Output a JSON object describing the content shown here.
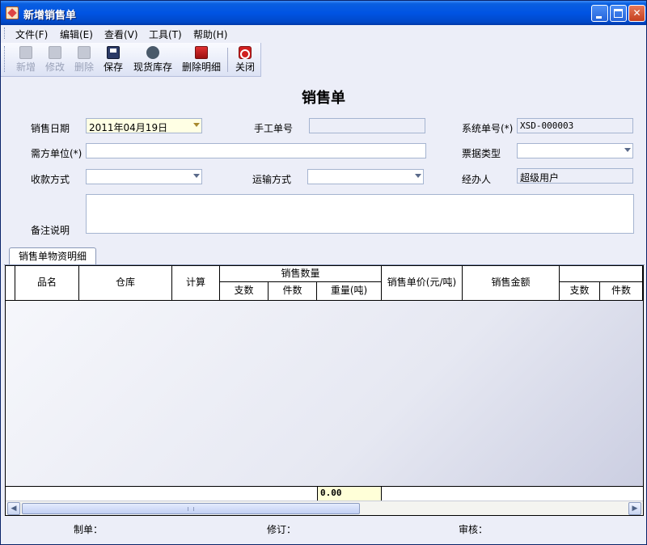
{
  "window": {
    "title": "新增销售单"
  },
  "menu": [
    {
      "label": "文件(F)"
    },
    {
      "label": "编辑(E)"
    },
    {
      "label": "查看(V)"
    },
    {
      "label": "工具(T)"
    },
    {
      "label": "帮助(H)"
    }
  ],
  "toolbar": {
    "new": "新增",
    "edit": "修改",
    "delete": "删除",
    "save": "保存",
    "stock": "现货库存",
    "delete_detail": "删除明细",
    "close": "关闭"
  },
  "form": {
    "title": "销售单",
    "sale_date_label": "销售日期",
    "sale_date_value": "2011年04月19日",
    "manual_no_label": "手工单号",
    "manual_no_value": "",
    "system_no_label": "系统单号(*)",
    "system_no_value": "XSD-000003",
    "buyer_label": "需方单位(*)",
    "buyer_value": "",
    "invoice_type_label": "票据类型",
    "invoice_type_value": "",
    "payment_label": "收款方式",
    "payment_value": "",
    "transport_label": "运输方式",
    "transport_value": "",
    "handler_label": "经办人",
    "handler_value": "超级用户",
    "remark_label": "备注说明",
    "remark_value": ""
  },
  "tab": {
    "label": "销售单物资明细"
  },
  "grid": {
    "headers": {
      "name": "品名",
      "warehouse": "仓库",
      "measure": "计算",
      "sale_qty": "销售数量",
      "pieces_count": "支数",
      "items_count": "件数",
      "weight": "重量(吨)",
      "unit_price": "销售单价(元/吨)",
      "amount": "销售金额",
      "extra_pieces": "支数",
      "extra_items": "件数"
    },
    "total_weight": "0.00"
  },
  "status": {
    "maker_label": "制单：",
    "reviser_label": "修订：",
    "auditor_label": "审核："
  }
}
